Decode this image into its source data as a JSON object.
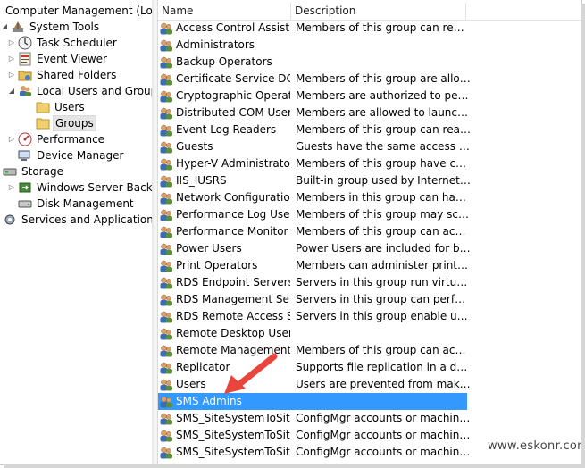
{
  "tree": {
    "root": "Computer Management (Local",
    "items": [
      {
        "label": "System Tools",
        "icon": "tools-icon",
        "expander": "open"
      },
      {
        "label": "Task Scheduler",
        "icon": "clock-icon",
        "expander": "closed"
      },
      {
        "label": "Event Viewer",
        "icon": "event-viewer-icon",
        "expander": "closed"
      },
      {
        "label": "Shared Folders",
        "icon": "shared-folder-icon",
        "expander": "closed"
      },
      {
        "label": "Local Users and Groups",
        "icon": "users-icon",
        "expander": "open"
      },
      {
        "label": "Users",
        "icon": "folder-icon",
        "expander": ""
      },
      {
        "label": "Groups",
        "icon": "folder-icon",
        "expander": ""
      },
      {
        "label": "Performance",
        "icon": "performance-icon",
        "expander": "closed"
      },
      {
        "label": "Device Manager",
        "icon": "device-manager-icon",
        "expander": ""
      },
      {
        "label": "Storage",
        "icon": "storage-icon",
        "expander": "open"
      },
      {
        "label": "Windows Server Backup",
        "icon": "backup-icon",
        "expander": "closed"
      },
      {
        "label": "Disk Management",
        "icon": "disk-icon",
        "expander": ""
      },
      {
        "label": "Services and Applications",
        "icon": "services-icon",
        "expander": "closed"
      }
    ]
  },
  "list": {
    "columns": {
      "name": "Name",
      "description": "Description"
    },
    "rows": [
      {
        "name": "Access Control Assist...",
        "description": "Members of this group can remot..."
      },
      {
        "name": "Administrators",
        "description": ""
      },
      {
        "name": "Backup Operators",
        "description": ""
      },
      {
        "name": "Certificate Service DC...",
        "description": "Members of this group are allowe..."
      },
      {
        "name": "Cryptographic Operat...",
        "description": "Members are authorized to perfor..."
      },
      {
        "name": "Distributed COM Users",
        "description": "Members are allowed to launch, a..."
      },
      {
        "name": "Event Log Readers",
        "description": "Members of this group can read e..."
      },
      {
        "name": "Guests",
        "description": "Guests have the same access as m..."
      },
      {
        "name": "Hyper-V Administrators",
        "description": "Members of this group have com..."
      },
      {
        "name": "IIS_IUSRS",
        "description": "Built-in group used by Internet Inf..."
      },
      {
        "name": "Network Configuratio...",
        "description": "Members in this group can have s..."
      },
      {
        "name": "Performance Log Users",
        "description": "Members of this group may sche..."
      },
      {
        "name": "Performance Monitor ...",
        "description": "Members of this group can acces..."
      },
      {
        "name": "Power Users",
        "description": "Power Users are included for back..."
      },
      {
        "name": "Print Operators",
        "description": "Members can administer printers ..."
      },
      {
        "name": "RDS Endpoint Servers",
        "description": "Servers in this group run virtual m..."
      },
      {
        "name": "RDS Management Ser...",
        "description": "Servers in this group can perform ..."
      },
      {
        "name": "RDS Remote Access S...",
        "description": "Servers in this group enable users ..."
      },
      {
        "name": "Remote Desktop Users",
        "description": ""
      },
      {
        "name": "Remote Management...",
        "description": "Members of this group can acces..."
      },
      {
        "name": "Replicator",
        "description": "Supports file replication in a dom..."
      },
      {
        "name": "Users",
        "description": "Users are prevented from making ..."
      },
      {
        "name": "SMS Admins",
        "description": "",
        "selected": true
      },
      {
        "name": "SMS_SiteSystemToSit...",
        "description": "ConfigMgr accounts or machine ..."
      },
      {
        "name": "SMS_SiteSystemToSit...",
        "description": "ConfigMgr accounts or machine ..."
      },
      {
        "name": "SMS_SiteSystemToSit...",
        "description": "ConfigMgr accounts or machine ..."
      }
    ]
  },
  "watermark": "www.eskonr.com",
  "colors": {
    "selection": "#3399ff",
    "arrow": "#e8453c"
  }
}
